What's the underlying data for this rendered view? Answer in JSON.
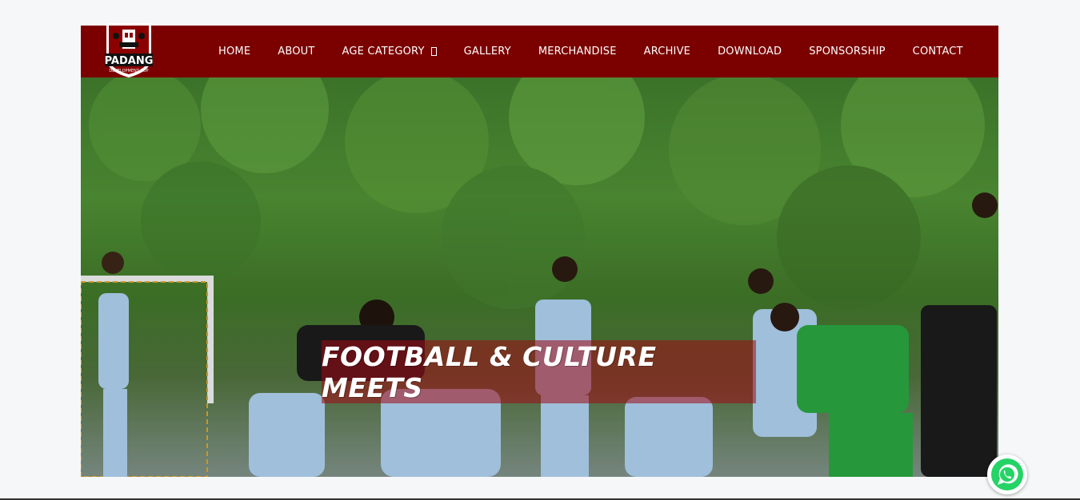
{
  "brand": {
    "logo_name": "PADANG",
    "logo_subtitle": "DEVELOPMENT CUP",
    "colors": {
      "navbar": "#7b0000",
      "banner": "#a00a14",
      "whatsapp": "#25d366"
    }
  },
  "nav": {
    "items": [
      {
        "label": "HOME"
      },
      {
        "label": "ABOUT"
      },
      {
        "label": "AGE CATEGORY",
        "has_dropdown": true
      },
      {
        "label": "GALLERY"
      },
      {
        "label": "MERCHANDISE"
      },
      {
        "label": "ARCHIVE"
      },
      {
        "label": "DOWNLOAD"
      },
      {
        "label": "SPONSORSHIP"
      },
      {
        "label": "CONTACT"
      }
    ]
  },
  "hero": {
    "title": "FOOTBALL & CULTURE MEETS",
    "image": "youth-football-team-photo"
  },
  "floating": {
    "icon": "whatsapp-icon"
  }
}
